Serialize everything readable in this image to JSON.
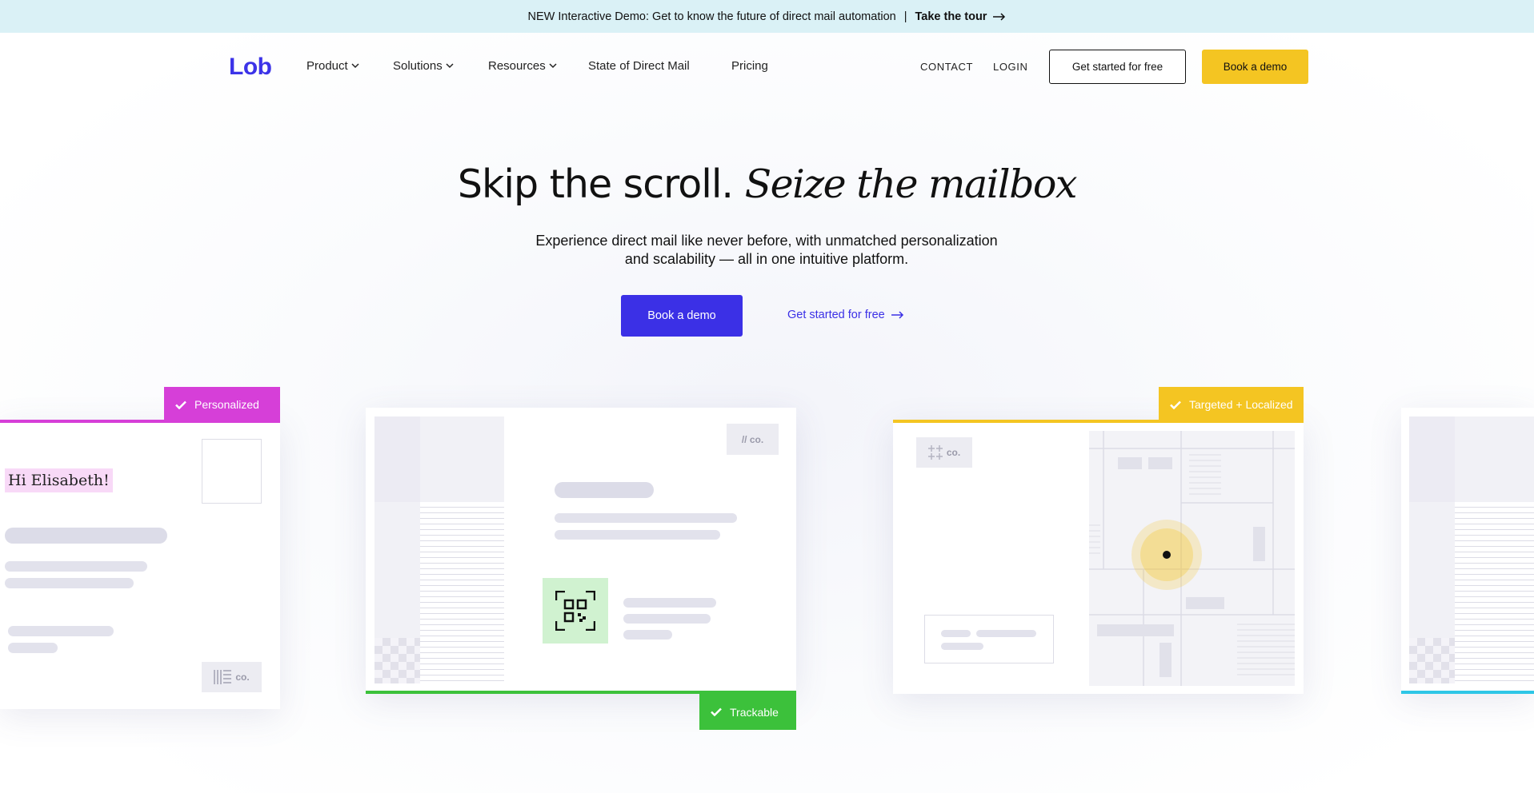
{
  "banner": {
    "text": "NEW Interactive Demo: Get to know the future of direct mail automation",
    "separator": "|",
    "link": "Take the tour"
  },
  "nav": {
    "logo": "Lob",
    "items": [
      {
        "label": "Product"
      },
      {
        "label": "Solutions"
      },
      {
        "label": "Resources"
      },
      {
        "label": "State of Direct Mail"
      },
      {
        "label": "Pricing"
      }
    ],
    "contact": "CONTACT",
    "login": "LOGIN",
    "cta_outline": "Get started for free",
    "cta_primary": "Book a demo"
  },
  "hero": {
    "title_plain": "Skip the scroll.",
    "title_italic": "Seize the mailbox",
    "subtitle_line1": "Experience direct mail like never before, with unmatched personalization",
    "subtitle_line2": "and scalability — all in one intuitive platform.",
    "primary_button": "Book a demo",
    "secondary_link": "Get started for free"
  },
  "cards": {
    "personalized": {
      "tag": "Personalized",
      "greeting": "Hi Elisabeth!",
      "brand": "co.",
      "color": "#d63fd8"
    },
    "trackable": {
      "tag": "Trackable",
      "brand": "// co.",
      "color": "#3cc13b"
    },
    "targeted": {
      "tag": "Targeted + Localized",
      "brand": "co.",
      "color": "#f4c522"
    },
    "partial": {
      "color": "#2ec6e6"
    }
  },
  "colors": {
    "brand_blue": "#3b30e6",
    "banner_bg": "#daf1f6",
    "yellow": "#f4c522"
  }
}
